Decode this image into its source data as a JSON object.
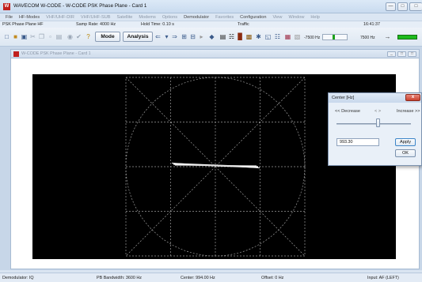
{
  "app": {
    "title": "WAVECOM W-CODE - W-CODE PSK Phase Plane - Card 1",
    "icon_letter": "W"
  },
  "menu": [
    {
      "label": "File",
      "disabled": false
    },
    {
      "label": "HF-Modes",
      "disabled": false
    },
    {
      "label": "VHF/UHF-DIR",
      "disabled": true
    },
    {
      "label": "VHF/UHF-SUB",
      "disabled": true
    },
    {
      "label": "Satellite",
      "disabled": true
    },
    {
      "label": "Modems",
      "disabled": true
    },
    {
      "label": "Options",
      "disabled": true
    },
    {
      "label": "Demodulator",
      "disabled": false
    },
    {
      "label": "Favorites",
      "disabled": true
    },
    {
      "label": "Configuration",
      "disabled": false
    },
    {
      "label": "View",
      "disabled": true
    },
    {
      "label": "Window",
      "disabled": true
    },
    {
      "label": "Help",
      "disabled": true
    }
  ],
  "infobar": {
    "mode": "PSK Phase Plane HF",
    "sample_rate": "Samp Rate: 4000 Hz",
    "hold_time": "Hold Time: 0.10 s",
    "traffic": "Traffic",
    "clock": "16:41:37"
  },
  "toolbar": {
    "mode_label": "Mode",
    "analysis_label": "Analysis",
    "freq_low": "-7500 Hz",
    "freq_high": "7500 Hz"
  },
  "child": {
    "title": "W-CODE PSK Phase Plane - Card 1"
  },
  "statusbar": {
    "demodulator": "Demodulator: IQ",
    "bandwidth": "PB Bandwidth: 3600 Hz",
    "center": "Center: 994.00 Hz",
    "offset": "Offset: 0 Hz",
    "input": "Input: AF (LEFT)"
  },
  "dialog": {
    "title": "Center [Hz]",
    "decrease": "<< Decrease",
    "arrows": "<   >",
    "increase": "Increase >>",
    "value": "993.30",
    "slider_fraction": 0.55,
    "apply": "Apply",
    "ok": "OK",
    "close": "x"
  },
  "colors": {
    "scope_bg": "#000000",
    "grid": "#9a9a9a",
    "trace": "#ffffff",
    "accent": "#c0201e"
  }
}
